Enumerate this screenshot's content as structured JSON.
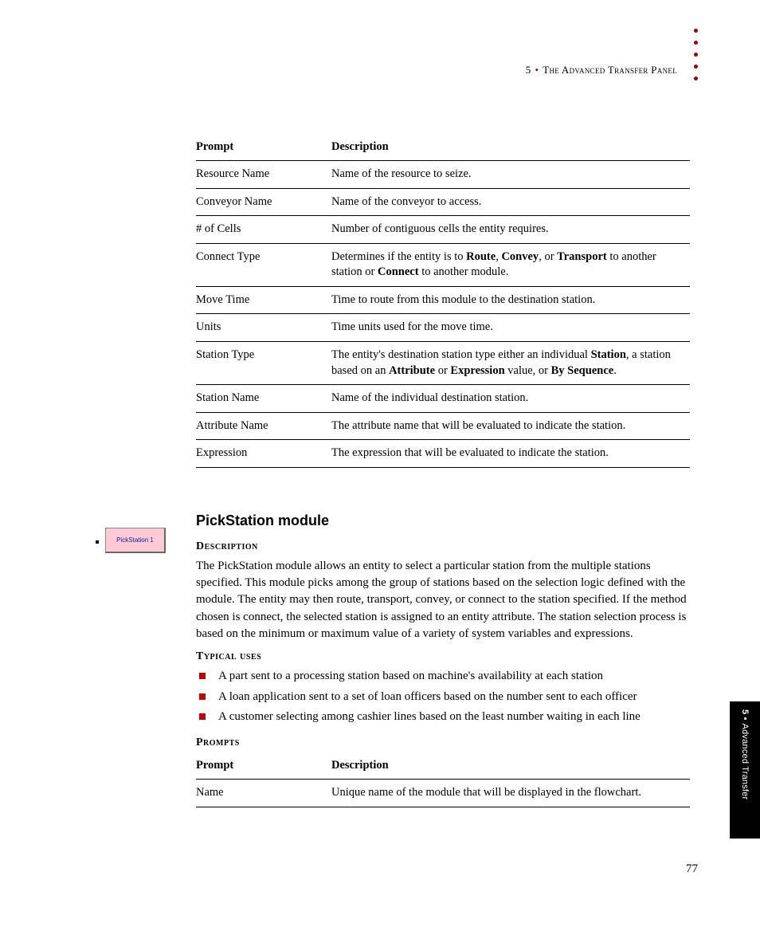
{
  "header": {
    "chapter_number": "5",
    "separator": "•",
    "chapter_title": "The Advanced Transfer Panel"
  },
  "table1": {
    "head": {
      "prompt": "Prompt",
      "description": "Description"
    },
    "rows": [
      {
        "prompt": "Resource Name",
        "description": "Name of the resource to seize."
      },
      {
        "prompt": "Conveyor Name",
        "description": "Name of the conveyor to access."
      },
      {
        "prompt": "# of Cells",
        "description": "Number of contiguous cells the entity requires."
      },
      {
        "prompt": "Connect Type",
        "description_html": "Determines if the entity is to <b>Route</b>, <b>Convey</b>, or <b>Transport</b> to another station or <b>Connect</b> to another module."
      },
      {
        "prompt": "Move Time",
        "description": "Time to route from this module to the destination station."
      },
      {
        "prompt": "Units",
        "description": "Time units used for the move time."
      },
      {
        "prompt": "Station Type",
        "description_html": "The entity's destination station type either an individual <b>Station</b>, a station based on an <b>Attribute</b> or <b>Expression</b> value, or <b>By Sequence</b>."
      },
      {
        "prompt": "Station Name",
        "description": "Name of the individual destination station."
      },
      {
        "prompt": "Attribute Name",
        "description": "The attribute name that will be evaluated to indicate the station."
      },
      {
        "prompt": "Expression",
        "description": "The expression that will be evaluated to indicate the station."
      }
    ]
  },
  "module": {
    "title": "PickStation module",
    "icon_label": "PickStation 1",
    "desc_heading": "Description",
    "description": "The PickStation module allows an entity to select a particular station from the multiple stations specified. This module picks among the group of stations based on the selection logic defined with the module. The entity may then route, transport, convey, or connect to the station specified. If the method chosen is connect, the selected station is assigned to an entity attribute. The station selection process is based on the minimum or maximum value of a variety of system variables and expressions.",
    "uses_heading": "Typical uses",
    "uses": [
      "A part sent to a processing station based on machine's availability at each station",
      "A loan application sent to a set of loan officers based on the number sent to each officer",
      "A customer selecting among cashier lines based on the least number waiting in each line"
    ],
    "prompts_heading": "Prompts"
  },
  "table2": {
    "head": {
      "prompt": "Prompt",
      "description": "Description"
    },
    "rows": [
      {
        "prompt": "Name",
        "description": "Unique name of the module that will be displayed in the flowchart."
      }
    ]
  },
  "side_tab": {
    "num": "5 •",
    "text": "Advanced Transfer"
  },
  "page_number": "77"
}
